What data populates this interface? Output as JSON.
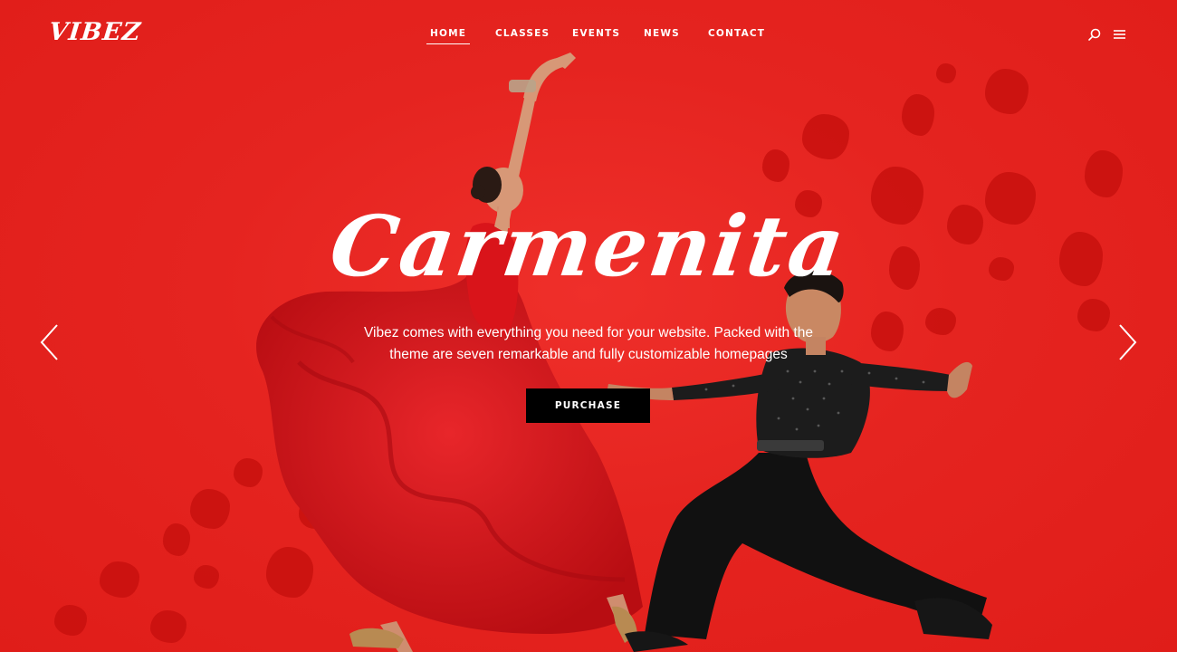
{
  "brand": {
    "logo_text": "VIBEZ"
  },
  "nav": {
    "items": [
      {
        "label": "HOME",
        "active": true
      },
      {
        "label": "CLASSES",
        "active": false
      },
      {
        "label": "EVENTS",
        "active": false
      },
      {
        "label": "NEWS",
        "active": false
      },
      {
        "label": "CONTACT",
        "active": false
      }
    ]
  },
  "header_icons": [
    "search-icon",
    "hamburger-menu-icon"
  ],
  "hero": {
    "title": "Carmenita",
    "subtitle_line1": "Vibez comes with everything you need for your website. Packed with the",
    "subtitle_line2": "theme are seven remarkable and fully customizable homepages",
    "cta_label": "PURCHASE"
  },
  "slider": {
    "prev_icon": "chevron-left-icon",
    "next_icon": "chevron-right-icon"
  },
  "colors": {
    "background": "#e52420",
    "accent_dark": "#000000",
    "text": "#ffffff",
    "dress": "#d8161a"
  }
}
